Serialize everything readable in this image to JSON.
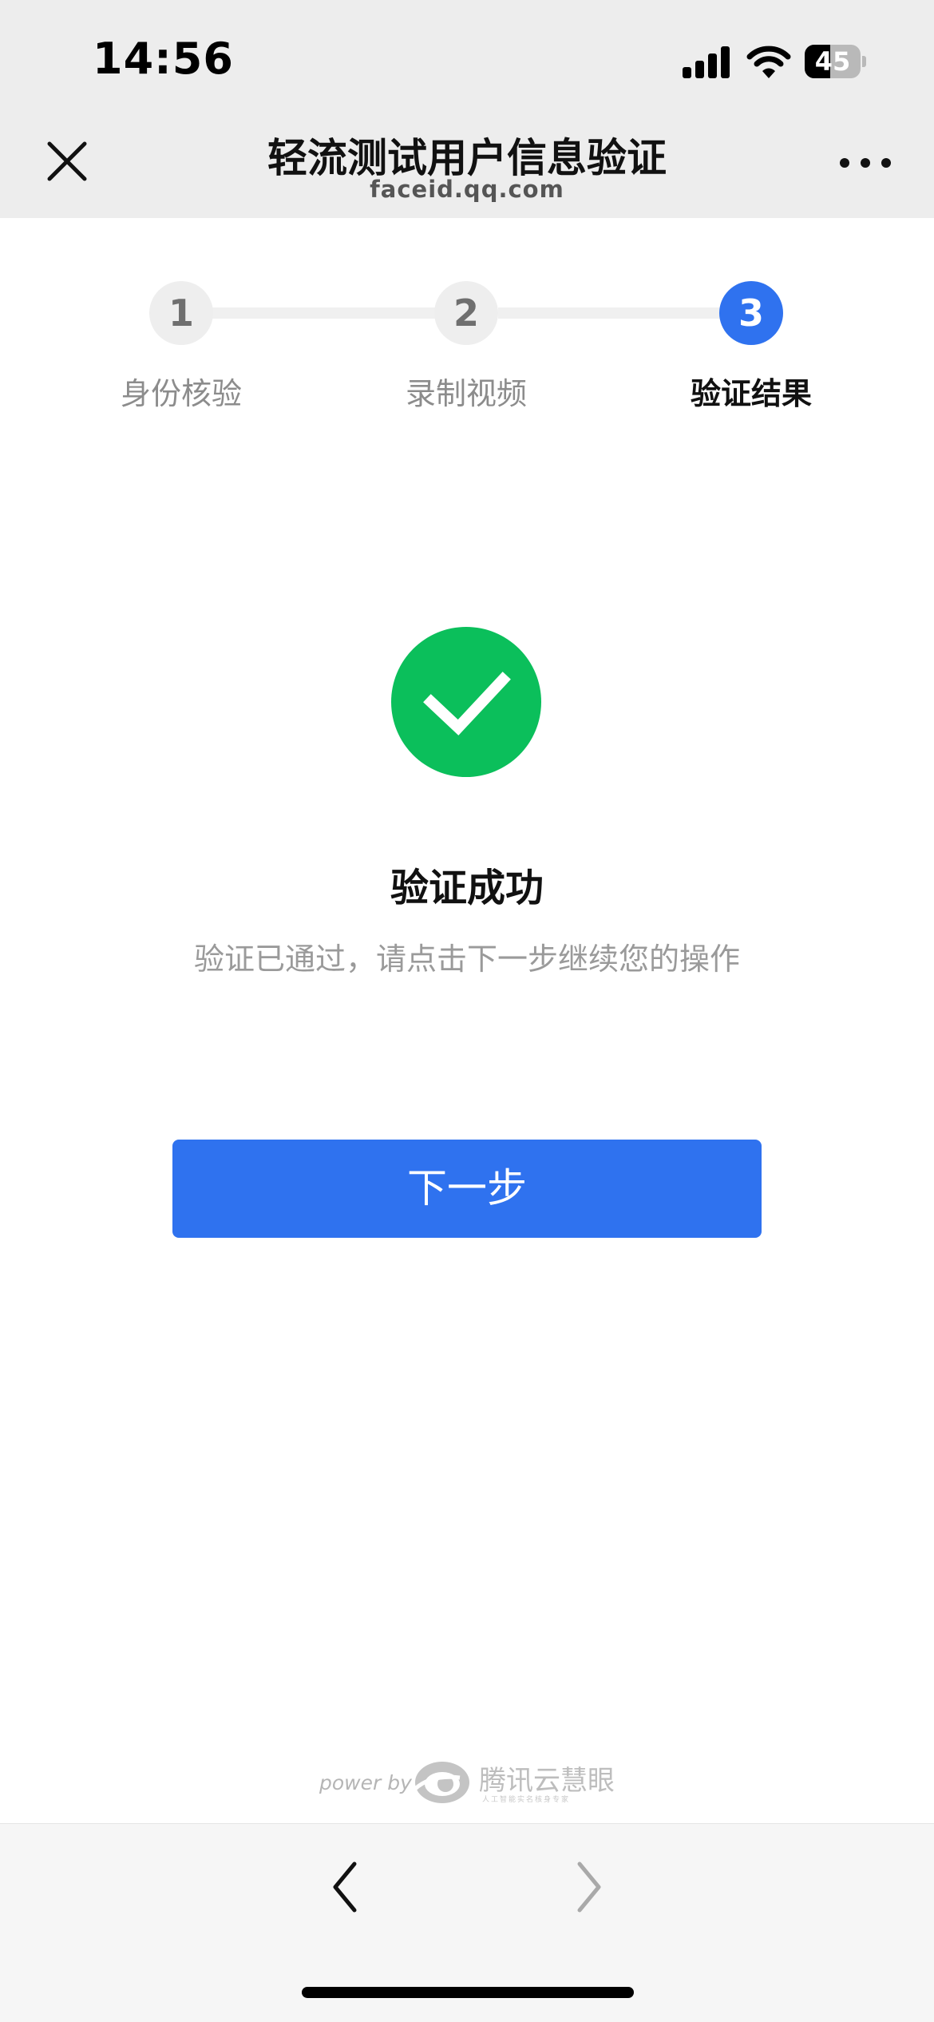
{
  "status_bar": {
    "time": "14:56",
    "battery_level": "45",
    "icons": [
      "signal-icon",
      "wifi-icon",
      "battery-icon"
    ]
  },
  "nav": {
    "title": "轻流测试用户信息验证",
    "subtitle": "faceid.qq.com",
    "close_icon": "close-icon",
    "more_icon": "more-icon"
  },
  "steps": [
    {
      "number": "1",
      "label": "身份核验",
      "active": false
    },
    {
      "number": "2",
      "label": "录制视频",
      "active": false
    },
    {
      "number": "3",
      "label": "验证结果",
      "active": true
    }
  ],
  "result": {
    "icon": "check-circle-icon",
    "title": "验证成功",
    "description": "验证已通过，请点击下一步继续您的操作"
  },
  "next_button": {
    "label": "下一步"
  },
  "footer": {
    "power_text": "power by",
    "brand_name": "腾讯云慧眼",
    "brand_sub": "人工智能实名核身专家"
  },
  "toolbar": {
    "back_icon": "chevron-left-icon",
    "forward_icon": "chevron-right-icon"
  },
  "colors": {
    "accent": "#2f72ef",
    "success": "#0bbf5b",
    "bar_bg": "#ededed"
  }
}
